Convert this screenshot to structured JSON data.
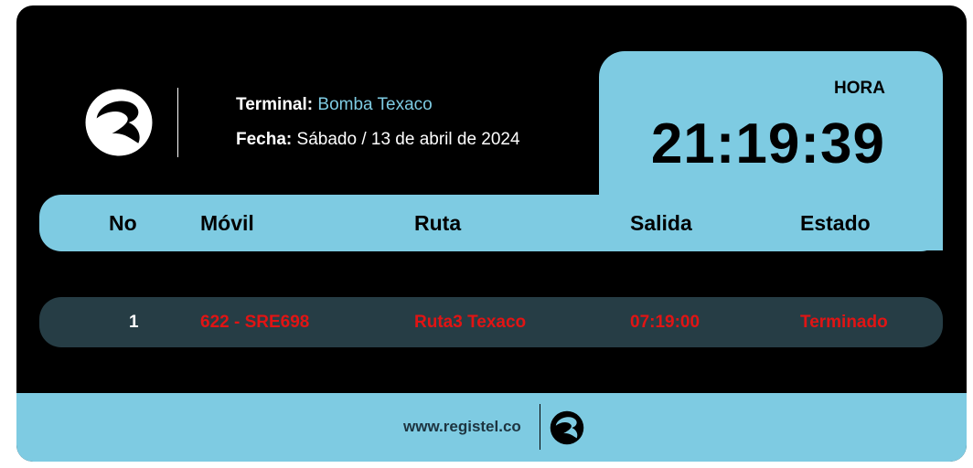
{
  "header": {
    "terminal_label": "Terminal:",
    "terminal_value": "Bomba Texaco",
    "fecha_label": "Fecha:",
    "fecha_value": "Sábado / 13 de abril de 2024"
  },
  "clock": {
    "label": "HORA",
    "time": "21:19:39"
  },
  "table": {
    "columns": [
      "No",
      "Móvil",
      "Ruta",
      "Salida",
      "Estado"
    ],
    "rows": [
      [
        "1",
        "622 - SRE698",
        "Ruta3 Texaco",
        "07:19:00",
        "Terminado"
      ]
    ]
  },
  "footer": {
    "url": "www.registel.co"
  },
  "colors": {
    "accent": "#7ecbe2",
    "background": "#000000",
    "row_bg": "#263d45",
    "status_text": "#e11414"
  },
  "icons": {
    "brand_logo": "registel-logo-icon"
  }
}
